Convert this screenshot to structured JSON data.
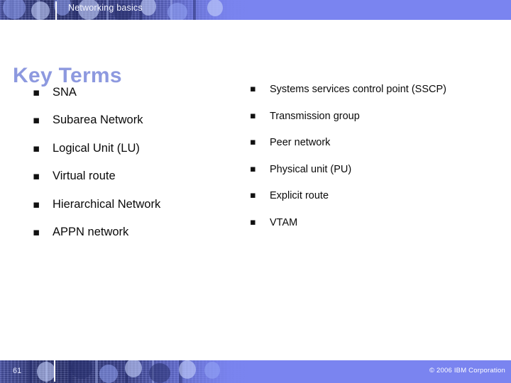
{
  "slide": {
    "header_title": "Networking basics",
    "title": "Key Terms",
    "footer": {
      "page_number": "61",
      "copyright": "© 2006 IBM Corporation"
    },
    "bullet_marker": "▪",
    "colors": {
      "band": "#7a84f0",
      "band_dark": "#2e3676",
      "title": "#8d99df",
      "body_text": "#0a0a0a",
      "header_text": "#f2f4ff"
    },
    "columns": {
      "left": [
        "SNA",
        "Subarea Network",
        "Logical Unit (LU)",
        "Virtual route",
        "Hierarchical Network",
        "APPN network"
      ],
      "right": [
        "Systems services control point (SSCP)",
        "Transmission group",
        "Peer network",
        "Physical unit (PU)",
        "Explicit route",
        "VTAM"
      ]
    }
  }
}
